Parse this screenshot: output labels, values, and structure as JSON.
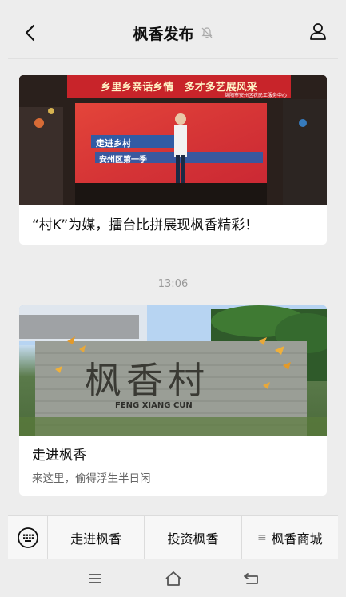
{
  "header": {
    "title": "枫香发布",
    "back_icon": "chevron-left-icon",
    "mute_icon": "bell-muted-icon",
    "profile_icon": "person-icon"
  },
  "feed": {
    "articles": [
      {
        "title": "“村K”为媒，擂台比拼展现枫香精彩！",
        "image": {
          "banner_text": "乡里乡亲话乡情   多才多艺展风采",
          "org_text": "绵阳市安州区农民工服务中心",
          "stage_line1": "走进乡村",
          "stage_line2": "安州区第一季"
        }
      },
      {
        "title": "走进枫香",
        "subtitle": "来这里，偷得浮生半日闲",
        "image": {
          "sign_text": "枫香村",
          "sign_pinyin": "FENG XIANG CUN"
        }
      }
    ],
    "timestamp": "13:06"
  },
  "menu": {
    "keyboard_icon": "keyboard-icon",
    "items": [
      {
        "label": "走进枫香"
      },
      {
        "label": "投资枫香"
      },
      {
        "label": "枫香商城",
        "prefix": "≡"
      }
    ]
  },
  "system_nav": {
    "menu_icon": "menu-icon",
    "home_icon": "home-icon",
    "back_icon": "back-arrow-icon"
  },
  "colors": {
    "background": "#ededed",
    "card": "#ffffff",
    "timestamp": "#9a9a9a",
    "banner_red": "#c8242a"
  }
}
